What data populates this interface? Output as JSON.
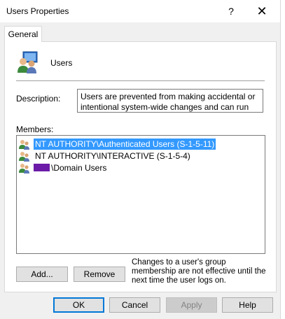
{
  "window": {
    "title": "Users Properties",
    "help_glyph": "?",
    "close_glyph": "✕"
  },
  "tabs": [
    {
      "label": "General",
      "active": true
    }
  ],
  "group": {
    "name": "Users",
    "icon": "users-group-icon"
  },
  "description": {
    "label": "Description:",
    "value": "Users are prevented from making accidental or intentional system-wide changes and can run most"
  },
  "members": {
    "label": "Members:",
    "items": [
      {
        "name": "NT AUTHORITY\\Authenticated Users (S-1-5-11)",
        "selected": true,
        "icon": "users-icon"
      },
      {
        "name": "NT AUTHORITY\\INTERACTIVE (S-1-5-4)",
        "selected": false,
        "icon": "users-icon"
      },
      {
        "name": "\\Domain Users",
        "selected": false,
        "icon": "users-icon",
        "redacted_prefix": true
      }
    ]
  },
  "actions": {
    "add_label": "Add...",
    "remove_label": "Remove"
  },
  "note": "Changes to a user's group membership are not effective until the next time the user logs on.",
  "footer": {
    "ok_label": "OK",
    "cancel_label": "Cancel",
    "apply_label": "Apply",
    "help_label": "Help"
  },
  "colors": {
    "selection": "#3399ff",
    "accent": "#0078d7",
    "redaction": "#6b1ba7"
  }
}
